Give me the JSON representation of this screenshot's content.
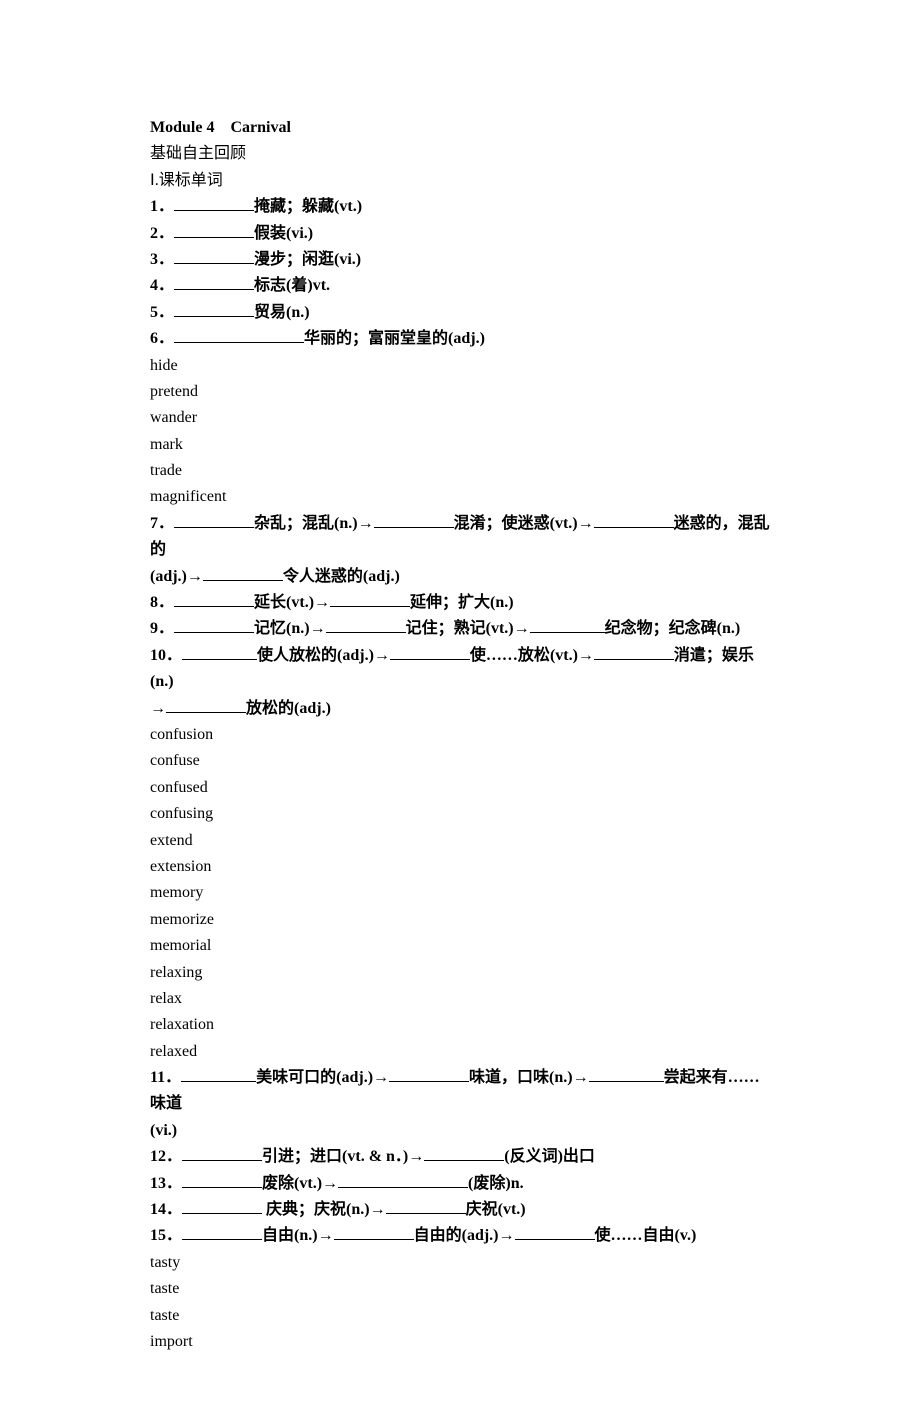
{
  "title": "Module 4　Carnival",
  "sub1": "基础自主回顾",
  "sub2": "Ⅰ.课标单词",
  "q1": {
    "def": "掩藏；躲藏",
    "pos": "(vt.)"
  },
  "q2": {
    "def": "假装",
    "pos": "(vi.)"
  },
  "q3": {
    "def": "漫步；闲逛",
    "pos": "(vi.)"
  },
  "q4": {
    "def": "标志(着)",
    "pos": "vt."
  },
  "q5": {
    "def": "贸易",
    "pos": "(n.)"
  },
  "q6": {
    "def": "华丽的；富丽堂皇的",
    "pos": "(adj.)"
  },
  "a": {
    "hide": "hide",
    "pretend": "pretend",
    "wander": "wander",
    "mark": "mark",
    "trade": "trade",
    "magnificent": "magnificent"
  },
  "q7": {
    "d1": "杂乱；混乱",
    "p1": "(n.)→",
    "d2": "混淆；使迷惑",
    "p2": "(vt.)→",
    "d3": "迷惑的，混乱的",
    "p3": "(adj.)→",
    "d4": "令人迷惑的",
    "p4": "(adj.)"
  },
  "q8": {
    "d1": "延长",
    "p1": "(vt.)→",
    "d2": "延伸；扩大",
    "p2": "(n.)"
  },
  "q9": {
    "d1": "记忆",
    "p1": "(n.)→",
    "d2": "记住；熟记",
    "p2": "(vt.)→",
    "d3": "纪念物；纪念碑",
    "p3": "(n.)"
  },
  "q10": {
    "d1": "使人放松的",
    "p1": "(adj.)→",
    "d2": "使……放松",
    "p2": "(vt.)→",
    "d3": "消遣；娱乐",
    "p3": "(n.)",
    "arrow": "→",
    "d4": "放松的",
    "p4": "(adj.)"
  },
  "a2": {
    "confusion": "confusion",
    "confuse": "confuse",
    "confused": "confused",
    "confusing": "confusing",
    "extend": "extend",
    "extension": "extension",
    "memory": "memory",
    "memorize": "memorize",
    "memorial": "memorial",
    "relaxing": "relaxing",
    "relax": "relax",
    "relaxation": "relaxation",
    "relaxed": "relaxed"
  },
  "q11": {
    "d1": "美味可口的",
    "p1": "(adj.)→",
    "d2": "味道，口味",
    "p2": "(n.)→",
    "d3": "尝起来有……味道",
    "p3": "(vi.)"
  },
  "q12": {
    "d1": "引进；进口",
    "p1": "(vt. & n．)→",
    "d2": "(反义词)出口"
  },
  "q13": {
    "d1": "废除",
    "p1": "(vt.)→",
    "d2": "(废除)",
    "p2": "n."
  },
  "q14": {
    "d1": "庆典；庆祝",
    "p1": "(n.)→",
    "d2": "庆祝",
    "p2": "(vt.)"
  },
  "q15": {
    "d1": "自由",
    "p1": "(n.)→",
    "d2": "自由的",
    "p2": "(adj.)→",
    "d3": "使……自由",
    "p3": "(v.)"
  },
  "a3": {
    "tasty": "tasty",
    "taste1": "taste",
    "taste2": "taste",
    "import": "import"
  }
}
